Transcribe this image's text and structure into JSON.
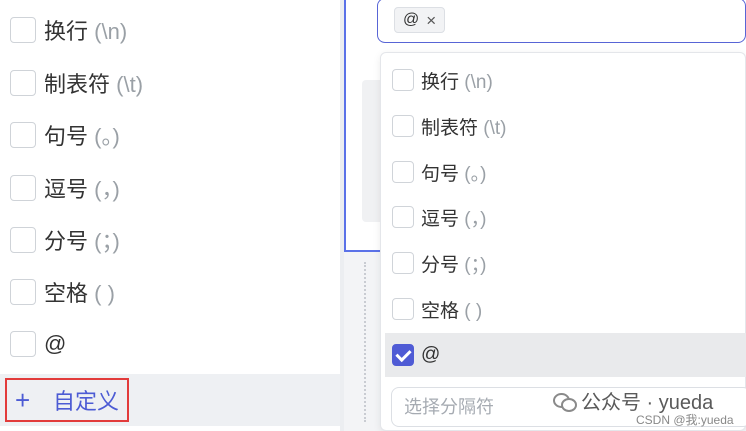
{
  "left_list": {
    "items": [
      {
        "label": "换行",
        "hint": "(\\n)"
      },
      {
        "label": "制表符",
        "hint": "(\\t)"
      },
      {
        "label": "句号",
        "hint": "(。)"
      },
      {
        "label": "逗号",
        "hint": "(，)"
      },
      {
        "label": "分号",
        "hint": "(；)"
      },
      {
        "label": "空格",
        "hint": "( )"
      },
      {
        "label": "@",
        "hint": ""
      }
    ],
    "custom": {
      "icon": "+",
      "label": "自定义"
    }
  },
  "select": {
    "tags": [
      {
        "label": "@",
        "remove_icon": "×"
      }
    ]
  },
  "dropdown": {
    "items": [
      {
        "label": "换行",
        "hint": "(\\n)",
        "checked": false
      },
      {
        "label": "制表符",
        "hint": "(\\t)",
        "checked": false
      },
      {
        "label": "句号",
        "hint": "(。)",
        "checked": false
      },
      {
        "label": "逗号",
        "hint": "(，)",
        "checked": false
      },
      {
        "label": "分号",
        "hint": "(；)",
        "checked": false
      },
      {
        "label": "空格",
        "hint": "( )",
        "checked": false
      },
      {
        "label": "@",
        "hint": "",
        "checked": true
      }
    ],
    "search_placeholder": "选择分隔符"
  },
  "watermark": {
    "text": "公众号 · yueda",
    "csdn": "CSDN @我:yueda"
  },
  "colors": {
    "accent": "#4f5bd5",
    "highlight_border": "#e23b3b",
    "hint": "#9aa0a6"
  }
}
